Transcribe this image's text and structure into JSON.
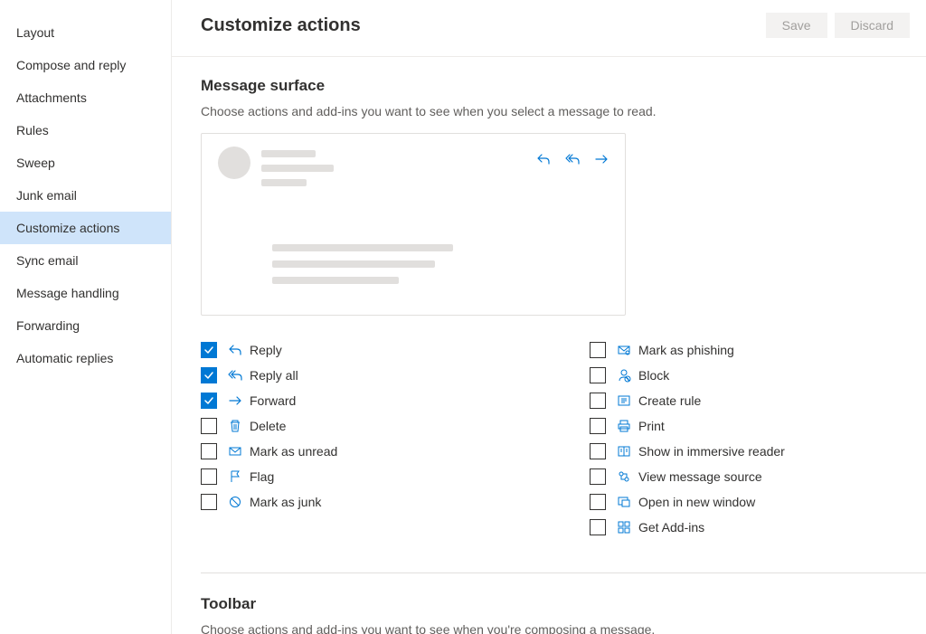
{
  "sidebar": {
    "items": [
      {
        "label": "Layout"
      },
      {
        "label": "Compose and reply"
      },
      {
        "label": "Attachments"
      },
      {
        "label": "Rules"
      },
      {
        "label": "Sweep"
      },
      {
        "label": "Junk email"
      },
      {
        "label": "Customize actions"
      },
      {
        "label": "Sync email"
      },
      {
        "label": "Message handling"
      },
      {
        "label": "Forwarding"
      },
      {
        "label": "Automatic replies"
      }
    ],
    "active_index": 6
  },
  "header": {
    "title": "Customize actions",
    "save": "Save",
    "discard": "Discard"
  },
  "section1": {
    "title": "Message surface",
    "desc": "Choose actions and add-ins you want to see when you select a message to read."
  },
  "actions_left": [
    {
      "label": "Reply",
      "checked": true,
      "icon": "reply"
    },
    {
      "label": "Reply all",
      "checked": true,
      "icon": "replyall"
    },
    {
      "label": "Forward",
      "checked": true,
      "icon": "forward"
    },
    {
      "label": "Delete",
      "checked": false,
      "icon": "delete"
    },
    {
      "label": "Mark as unread",
      "checked": false,
      "icon": "unread"
    },
    {
      "label": "Flag",
      "checked": false,
      "icon": "flag"
    },
    {
      "label": "Mark as junk",
      "checked": false,
      "icon": "junk"
    }
  ],
  "actions_right": [
    {
      "label": "Mark as phishing",
      "checked": false,
      "icon": "phishing"
    },
    {
      "label": "Block",
      "checked": false,
      "icon": "block"
    },
    {
      "label": "Create rule",
      "checked": false,
      "icon": "rule"
    },
    {
      "label": "Print",
      "checked": false,
      "icon": "print"
    },
    {
      "label": "Show in immersive reader",
      "checked": false,
      "icon": "reader"
    },
    {
      "label": "View message source",
      "checked": false,
      "icon": "source"
    },
    {
      "label": "Open in new window",
      "checked": false,
      "icon": "window"
    },
    {
      "label": "Get Add-ins",
      "checked": false,
      "icon": "addins"
    }
  ],
  "section2": {
    "title": "Toolbar",
    "desc": "Choose actions and add-ins you want to see when you're composing a message."
  }
}
